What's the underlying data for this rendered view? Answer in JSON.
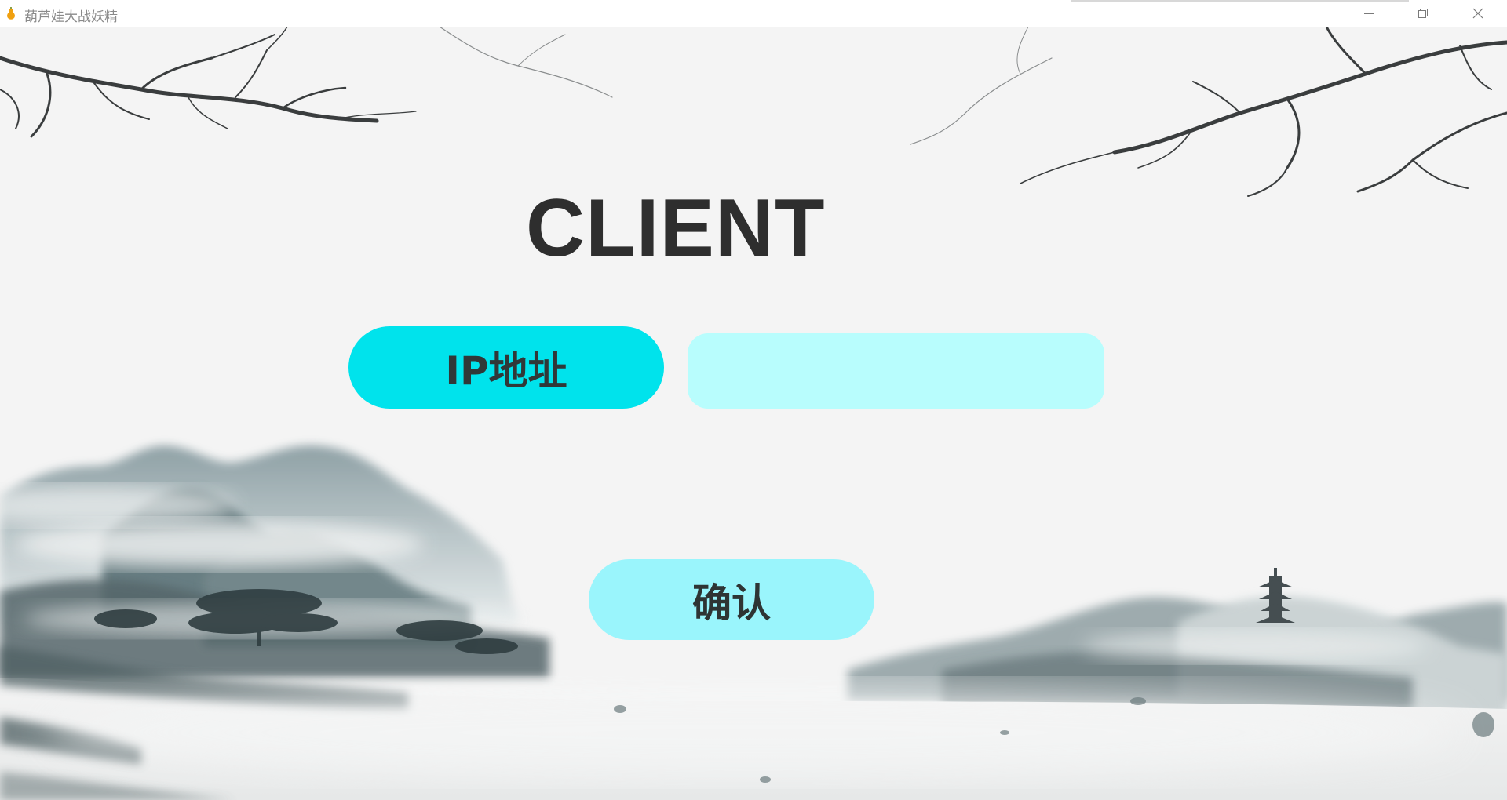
{
  "window": {
    "title": "葫芦娃大战妖精",
    "icon": "gourd-icon",
    "controls": [
      "minimize-icon",
      "restore-icon",
      "close-icon"
    ]
  },
  "main": {
    "heading": "CLIENT",
    "ip_label": "IP地址",
    "ip_input": {
      "value": "",
      "placeholder": ""
    },
    "confirm_label": "确认"
  },
  "colors": {
    "background": "#f4f4f4",
    "ip_label_bg": "#00e3ec",
    "ip_input_bg": "#b8fdfd",
    "confirm_bg": "#9af5fc",
    "text_dark": "#2e2e2e",
    "ink": "#3a4448"
  }
}
